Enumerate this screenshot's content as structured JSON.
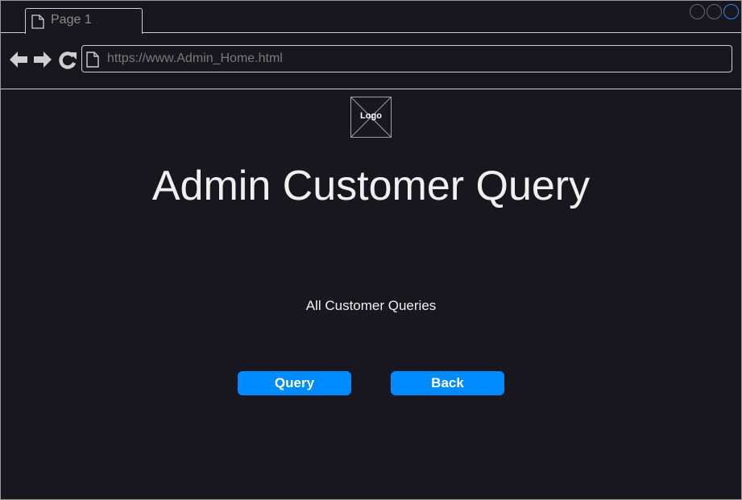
{
  "browser": {
    "tab_label": "Page 1",
    "url": "https://www.Admin_Home.html",
    "icons": {
      "tab": "page-icon",
      "back": "arrow-left-icon",
      "forward": "arrow-right-icon",
      "reload": "reload-icon",
      "url": "page-icon"
    },
    "window_controls": [
      "minimize",
      "maximize",
      "close"
    ],
    "accent_color": "#1e90ff"
  },
  "page": {
    "logo_label": "Logo",
    "title": "Admin Customer Query",
    "subtitle": "All Customer Queries",
    "buttons": {
      "query_label": "Query",
      "back_label": "Back"
    },
    "button_color": "#008cff",
    "background_color": "#18161f"
  }
}
